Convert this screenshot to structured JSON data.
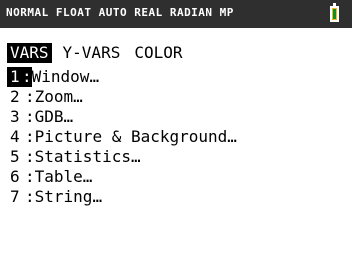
{
  "status_bar": {
    "text": "NORMAL FLOAT AUTO REAL RADIAN MP",
    "battery_color": "#f5b32a",
    "battery_level_color": "#0a8f2a"
  },
  "menu": {
    "tabs": [
      {
        "label": "VARS",
        "selected": true
      },
      {
        "label": "Y-VARS",
        "selected": false
      },
      {
        "label": "COLOR",
        "selected": false
      }
    ],
    "items": [
      {
        "number": "1",
        "label": "Window…",
        "selected": true
      },
      {
        "number": "2",
        "label": "Zoom…",
        "selected": false
      },
      {
        "number": "3",
        "label": "GDB…",
        "selected": false
      },
      {
        "number": "4",
        "label": "Picture & Background…",
        "selected": false
      },
      {
        "number": "5",
        "label": "Statistics…",
        "selected": false
      },
      {
        "number": "6",
        "label": "Table…",
        "selected": false
      },
      {
        "number": "7",
        "label": "String…",
        "selected": false
      }
    ]
  }
}
